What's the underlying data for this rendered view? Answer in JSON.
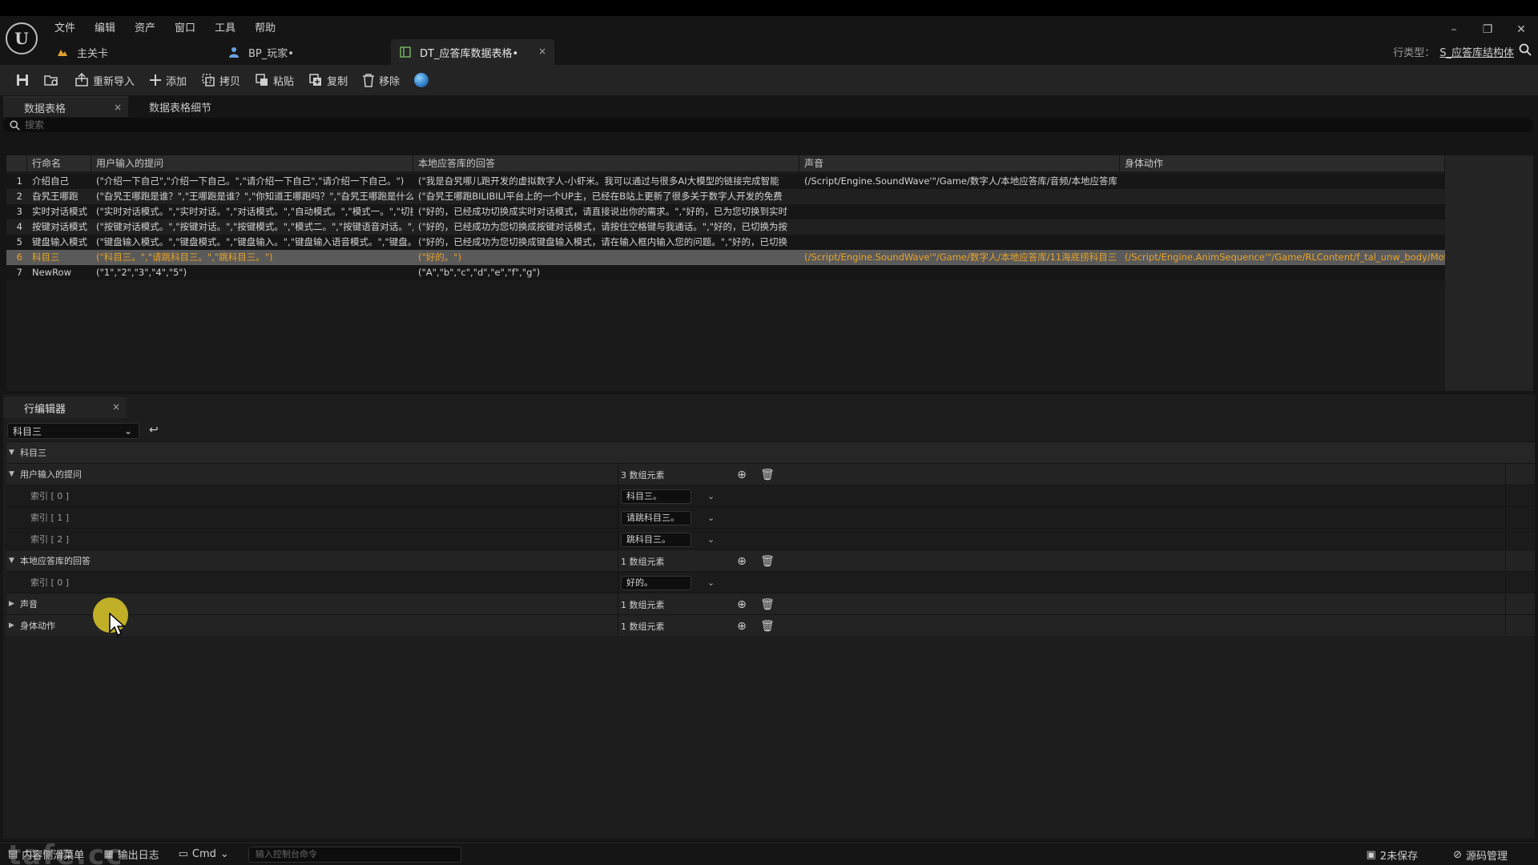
{
  "menu": [
    "文件",
    "编辑",
    "资产",
    "窗口",
    "工具",
    "帮助"
  ],
  "doc_tabs": [
    {
      "label": "主关卡",
      "icon": "level-icon"
    },
    {
      "label": "BP_玩家•",
      "icon": "pawn-icon"
    },
    {
      "label": "DT_应答库数据表格•",
      "icon": "datatable-icon",
      "close": "×"
    }
  ],
  "row_type": {
    "label": "行类型：",
    "value": "S_应答库结构体"
  },
  "toolbar": {
    "reimport": "重新导入",
    "add": "添加",
    "copy": "拷贝",
    "paste": "粘贴",
    "duplicate": "复制",
    "remove": "移除"
  },
  "panel_tabs": {
    "datatable": "数据表格",
    "details": "数据表格细节"
  },
  "search": {
    "placeholder": "搜索"
  },
  "table": {
    "columns": [
      "行命名",
      "用户输入的提问",
      "本地应答库的回答",
      "声音",
      "身体动作"
    ],
    "rows": [
      {
        "num": "1",
        "name": "介绍自己",
        "question": "(\"介绍一下自己\",\"介绍一下自己。\",\"请介绍一下自己\",\"请介绍一下自己。\")",
        "answer": "(\"我是旮旯哪儿跑开发的虚拟数字人-小虾米。我可以通过与很多AI大模型的链接完成智能",
        "sound": "(/Script/Engine.SoundWave'\"/Game/数字人/本地应答库/音频/本地应答库",
        "motion": ""
      },
      {
        "num": "2",
        "name": "旮旯王哪跑",
        "question": "(\"旮旯王哪跑是谁？\",\"王哪跑是谁？\",\"你知道王哪跑吗？\",\"旮旯王哪跑是什么",
        "answer": "(\"旮旯王哪跑BILIBILI平台上的一个UP主，已经在B站上更新了很多关于数字人开发的免费",
        "sound": "",
        "motion": ""
      },
      {
        "num": "3",
        "name": "实时对话模式",
        "question": "(\"实时对话模式。\",\"实时对话。\",\"对话模式。\",\"自动模式。\",\"模式一。\",\"切换",
        "answer": "(\"好的，已经成功切换成实时对话模式，请直接说出你的需求。\",\"好的，已为您切换到实时",
        "sound": "",
        "motion": ""
      },
      {
        "num": "4",
        "name": "按键对话模式",
        "question": "(\"按键对话模式。\",\"按键对话。\",\"按键模式。\",\"模式二。\",\"按键语音对话。\",\"切",
        "answer": "(\"好的，已经成功为您切换成按键对话模式，请按住空格键与我通话。\",\"好的，已切换为按",
        "sound": "",
        "motion": ""
      },
      {
        "num": "5",
        "name": "键盘输入模式",
        "question": "(\"键盘输入模式。\",\"键盘模式。\",\"键盘输入。\",\"键盘输入语音模式。\",\"键盘。",
        "answer": "(\"好的，已经成功为您切换成键盘输入模式，请在输入框内输入您的问题。\",\"好的，已切换",
        "sound": "",
        "motion": ""
      },
      {
        "num": "6",
        "name": "科目三",
        "question": "(\"科目三。\",\"请跳科目三。\",\"跳科目三。\")",
        "answer": "(\"好的。\")",
        "sound": "(/Script/Engine.SoundWave'\"/Game/数字人/本地应答库/11海底捞科目三",
        "motion": "(/Script/Engine.AnimSequence'\"/Game/RLContent/f_tal_unw_body/Motio"
      },
      {
        "num": "7",
        "name": "NewRow",
        "question": "(\"1\",\"2\",\"3\",\"4\",\"5\")",
        "answer": "(\"A\",\"b\",\"c\",\"d\",\"e\",\"f\",\"g\")",
        "sound": "",
        "motion": ""
      }
    ],
    "selected_row": 6
  },
  "row_editor": {
    "tab": "行编辑器",
    "selected_row": "科目三",
    "category": "科目三",
    "groups": {
      "question": {
        "label": "用户输入的提问",
        "count": "3 数组元素"
      },
      "answer": {
        "label": "本地应答库的回答",
        "count": "1 数组元素"
      },
      "sound": {
        "label": "声音",
        "count": "1 数组元素"
      },
      "motion": {
        "label": "身体动作",
        "count": "1 数组元素"
      }
    },
    "question_items": [
      {
        "index": "索引 [ 0 ]",
        "value": "科目三。"
      },
      {
        "index": "索引 [ 1 ]",
        "value": "请跳科目三。"
      },
      {
        "index": "索引 [ 2 ]",
        "value": "跳科目三。"
      }
    ],
    "answer_items": [
      {
        "index": "索引 [ 0 ]",
        "value": "好的。"
      }
    ]
  },
  "statusbar": {
    "content_drawer": "内容侧滑菜单",
    "output_log": "输出日志",
    "cmd": "Cmd",
    "cmd_placeholder": "输入控制台命令",
    "unsaved": "2未保存",
    "source_control": "源码管理"
  },
  "watermark": "tafe.cc",
  "colors": {
    "selected_row_text": "#e8a42a",
    "selected_row_bg": "#5a5a5a",
    "accent_cursor": "#dcc828"
  }
}
